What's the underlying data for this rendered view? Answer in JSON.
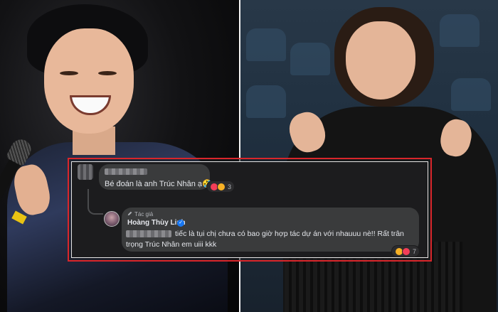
{
  "comments": {
    "top": {
      "text": "Bé đoán là anh Trúc Nhân ạ🤣",
      "reactions": [
        "heart-reaction",
        "care-reaction"
      ],
      "reaction_count": "3"
    },
    "reply": {
      "author_badge": "Tác giả",
      "author_name": "Hoàng Thùy Linh",
      "line1": "tiếc là tụi chị chưa có bao giờ hợp tác dự án với nhauuu nè!! Rất trân",
      "line2": "trọng Trúc Nhân em uiii kkk",
      "reactions": [
        "care-reaction",
        "heart-reaction"
      ],
      "reaction_count": "7"
    }
  },
  "colors": {
    "highlight_border": "#d9262b",
    "comment_bubble": "#3a3b3c",
    "verified_badge": "#1877f2",
    "heart_reaction": "#f33e58"
  }
}
